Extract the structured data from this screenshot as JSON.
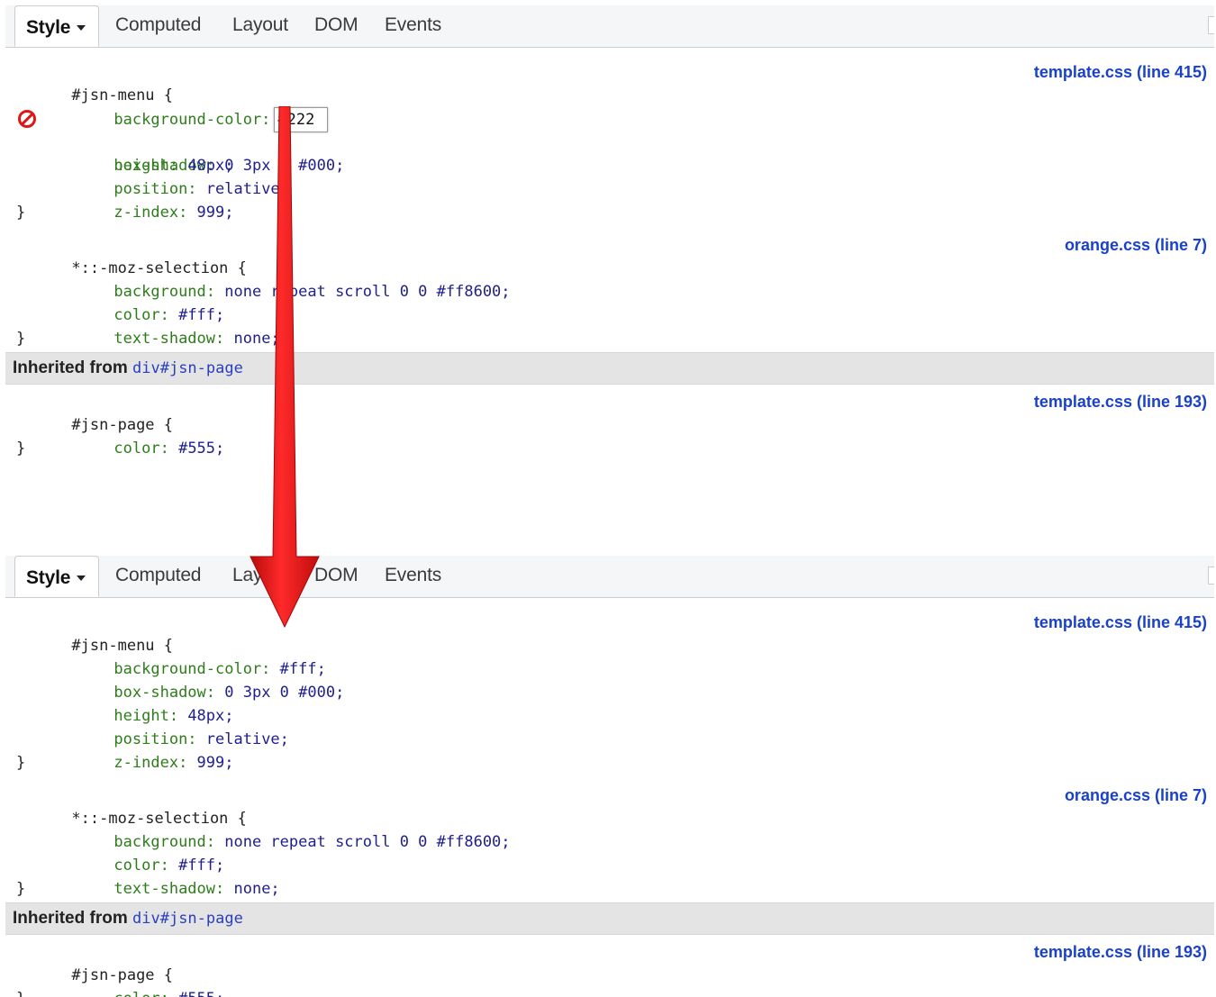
{
  "tabs": {
    "style": "Style",
    "computed": "Computed",
    "layout": "Layout",
    "dom": "DOM",
    "events": "Events"
  },
  "before": {
    "rules": [
      {
        "selector": "#jsn-menu {",
        "source": "template.css (line 415)",
        "decls": [
          {
            "prop": "background-color:",
            "value": "#222",
            "editing": true
          },
          {
            "prop": "box-shadow:",
            "value": " 0 3px 0 #000;",
            "disabled": true
          },
          {
            "prop": "height:",
            "value": " 48px;"
          },
          {
            "prop": "position:",
            "value": " relative;"
          },
          {
            "prop": "z-index:",
            "value": " 999;"
          }
        ]
      },
      {
        "selector": "*::-moz-selection {",
        "source": "orange.css (line 7)",
        "decls": [
          {
            "prop": "background:",
            "value": " none repeat scroll 0 0 #ff8600;"
          },
          {
            "prop": "color:",
            "value": " #fff;"
          },
          {
            "prop": "text-shadow:",
            "value": " none;"
          }
        ]
      }
    ],
    "inherited_label": "Inherited from",
    "inherited_element": "div#jsn-page",
    "inherited_rule": {
      "selector": "#jsn-page {",
      "source": "template.css (line 193)",
      "decls": [
        {
          "prop": "color:",
          "value": " #555;"
        }
      ]
    }
  },
  "after": {
    "rules": [
      {
        "selector": "#jsn-menu {",
        "source": "template.css (line 415)",
        "decls": [
          {
            "prop": "background-color:",
            "value": " #fff;"
          },
          {
            "prop": "box-shadow:",
            "value": " 0 3px 0 #000;"
          },
          {
            "prop": "height:",
            "value": " 48px;"
          },
          {
            "prop": "position:",
            "value": " relative;"
          },
          {
            "prop": "z-index:",
            "value": " 999;"
          }
        ]
      },
      {
        "selector": "*::-moz-selection {",
        "source": "orange.css (line 7)",
        "decls": [
          {
            "prop": "background:",
            "value": " none repeat scroll 0 0 #ff8600;"
          },
          {
            "prop": "color:",
            "value": " #fff;"
          },
          {
            "prop": "text-shadow:",
            "value": " none;"
          }
        ]
      }
    ],
    "inherited_label": "Inherited from",
    "inherited_element": "div#jsn-page",
    "inherited_rule": {
      "selector": "#jsn-page {",
      "source": "template.css (line 193)",
      "decls": [
        {
          "prop": "color:",
          "value": " #555;"
        }
      ]
    }
  },
  "close_brace": "}",
  "colors": {
    "property": "#2e7d1b",
    "value": "#20208e",
    "source_link": "#1a41c9",
    "disabled_icon": "#e01616",
    "arrow": "#e41010"
  },
  "icons": {
    "disabled": "disabled-declaration-icon",
    "dropdown": "caret-down-icon",
    "annotation": "red-down-arrow"
  }
}
